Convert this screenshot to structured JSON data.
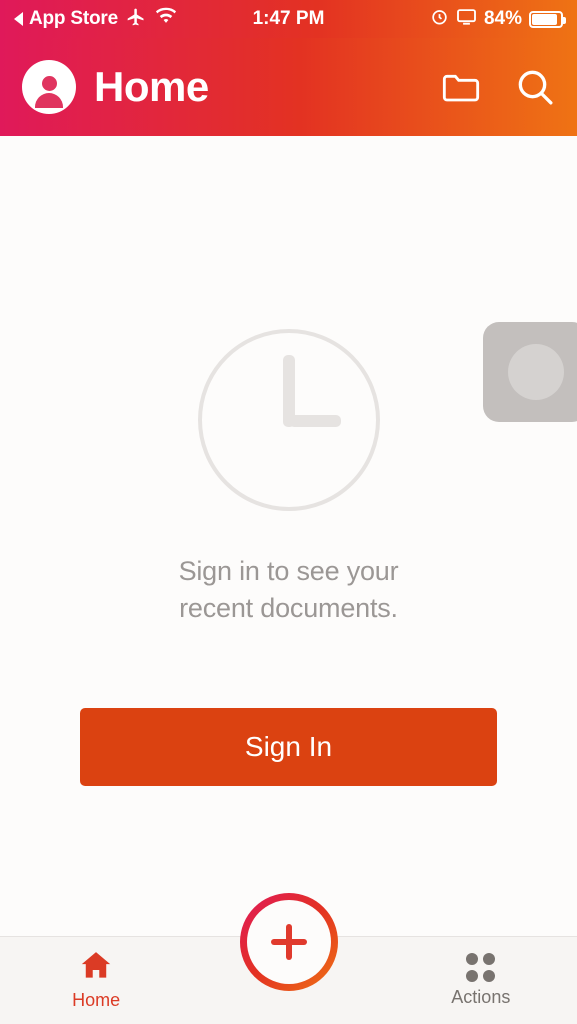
{
  "status_bar": {
    "back_label": "App Store",
    "back_icon": "back-triangle-icon",
    "airplane_icon": "airplane-mode-icon",
    "wifi_icon": "wifi-icon",
    "time": "1:47 PM",
    "alarm_icon": "alarm-clock-icon",
    "screen_mirror_icon": "screen-mirroring-icon",
    "battery_percent": "84%",
    "battery_level": 84,
    "battery_icon": "battery-icon"
  },
  "app_bar": {
    "avatar_icon": "account-avatar-icon",
    "title": "Home",
    "folder_icon": "folder-icon",
    "search_icon": "search-icon"
  },
  "main": {
    "empty_state": {
      "clock_icon": "clock-icon",
      "message_line1": "Sign in to see your",
      "message_line2": "recent documents."
    },
    "sign_in_button": "Sign In",
    "floating_thumbnail": "floating-thumbnail-overlay"
  },
  "tab_bar": {
    "tabs": [
      {
        "label": "Home",
        "icon": "home-icon",
        "active": true
      },
      {
        "label": "Actions",
        "icon": "grid-dots-icon",
        "active": false
      }
    ],
    "fab": {
      "icon": "plus-icon",
      "label": ""
    }
  },
  "colors": {
    "brand_gradient_start": "#e0195a",
    "brand_gradient_mid": "#e33222",
    "brand_gradient_end": "#ef7314",
    "primary_button": "#db4211",
    "active_tab": "#db3b25",
    "inactive_tab": "#78736f",
    "muted_text": "#9b9795",
    "page_background": "#fdfcfb"
  }
}
